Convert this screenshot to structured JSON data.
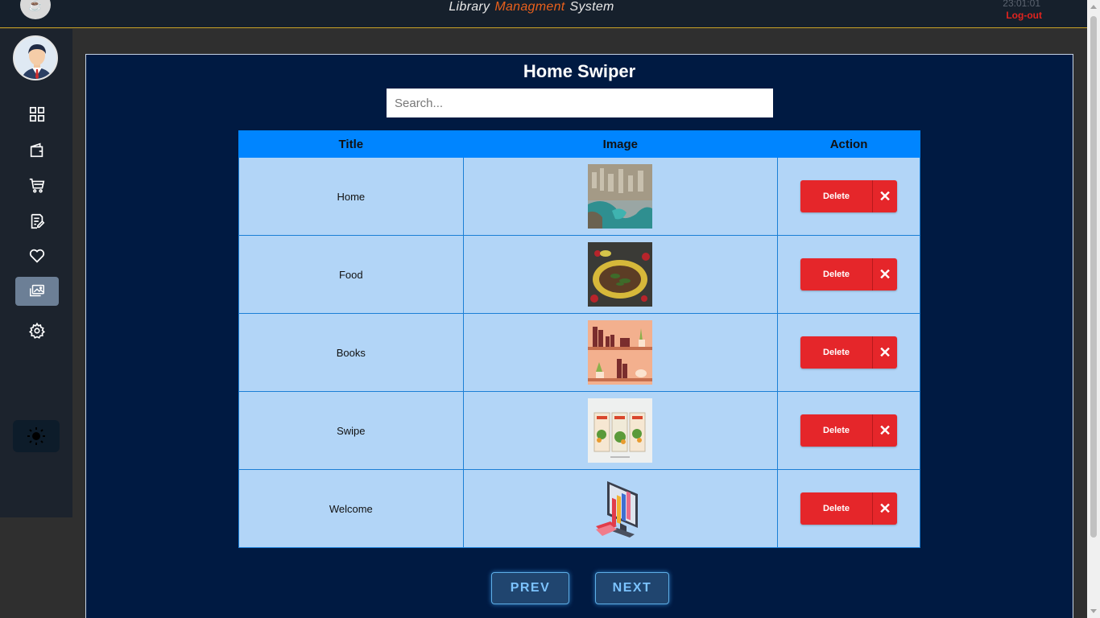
{
  "header": {
    "title_part1": "Library",
    "title_accent": "Managment",
    "title_part3": "System",
    "clock": "23:01:01",
    "logout": "Log-out"
  },
  "sidebar": {
    "items": [
      {
        "name": "dashboard",
        "icon": "grid-icon"
      },
      {
        "name": "wallet",
        "icon": "wallet-icon"
      },
      {
        "name": "cart",
        "icon": "cart-icon"
      },
      {
        "name": "orders",
        "icon": "edit-list-icon"
      },
      {
        "name": "favorites",
        "icon": "heart-icon"
      },
      {
        "name": "swiper",
        "icon": "images-icon",
        "active": true
      },
      {
        "name": "settings",
        "icon": "gear-icon"
      }
    ],
    "theme_icon": "sun-icon"
  },
  "main": {
    "title": "Home Swiper",
    "search_placeholder": "Search...",
    "columns": [
      "Title",
      "Image",
      "Action"
    ],
    "rows": [
      {
        "title": "Home",
        "image": "city-coast"
      },
      {
        "title": "Food",
        "image": "food-plate"
      },
      {
        "title": "Books",
        "image": "book-shelves"
      },
      {
        "title": "Swipe",
        "image": "posters"
      },
      {
        "title": "Welcome",
        "image": "computer-books"
      }
    ],
    "delete_label": "Delete",
    "delete_x": "✕",
    "prev_label": "PREV",
    "next_label": "NEXT"
  },
  "colors": {
    "accent": "#e9601c",
    "panel_bg": "#001a42",
    "table_header": "#0085ff",
    "row_bg": "#b2d5f7",
    "delete_red": "#e5262a"
  }
}
